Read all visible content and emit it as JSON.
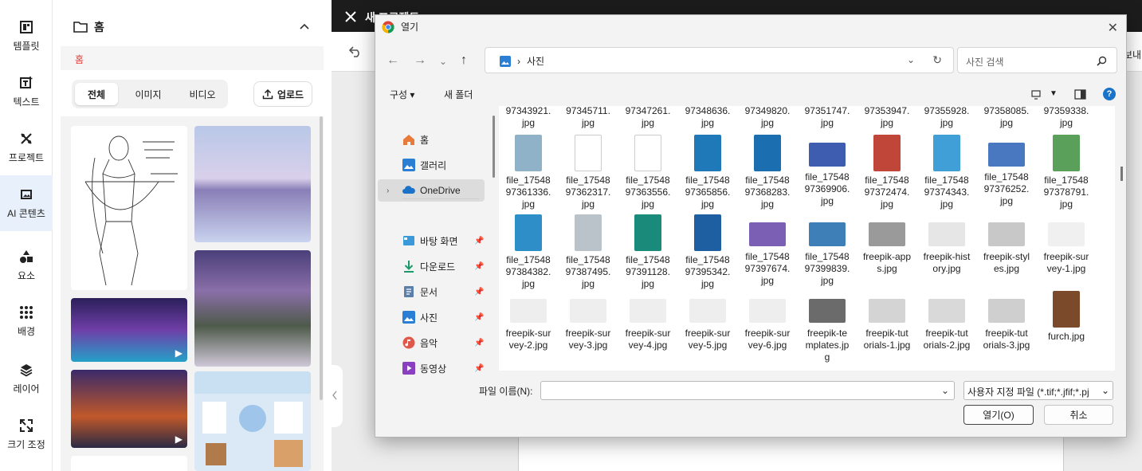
{
  "rail": [
    {
      "label": "템플릿",
      "icon": "template-icon"
    },
    {
      "label": "텍스트",
      "icon": "text-icon"
    },
    {
      "label": "프로젝트",
      "icon": "project-icon"
    },
    {
      "label": "AI 콘텐츠",
      "icon": "image-icon"
    },
    {
      "label": "요소",
      "icon": "shapes-icon"
    },
    {
      "label": "배경",
      "icon": "grid-dots-icon"
    },
    {
      "label": "레이어",
      "icon": "layers-icon"
    },
    {
      "label": "크기 조정",
      "icon": "resize-icon"
    }
  ],
  "panel": {
    "title": "홈",
    "breadcrumb": "홈",
    "filters": [
      "전체",
      "이미지",
      "비디오"
    ],
    "active_filter": "전체",
    "upload_label": "업로드"
  },
  "editor": {
    "title_fragment": "새 프로젝트",
    "export_fragment": "보내"
  },
  "dialog": {
    "title": "열기",
    "address_folder": "사진",
    "search_placeholder": "사진 검색",
    "organize_label": "구성",
    "new_folder_label": "새 폴더",
    "help_glyph": "?",
    "tree": [
      {
        "label": "홈",
        "icon": "home-icon"
      },
      {
        "label": "갤러리",
        "icon": "gallery-icon"
      },
      {
        "label": "OneDrive",
        "icon": "onedrive-icon",
        "selected": true
      },
      {
        "label": "바탕 화면",
        "icon": "desktop-icon",
        "pinned": true
      },
      {
        "label": "다운로드",
        "icon": "download-icon",
        "pinned": true
      },
      {
        "label": "문서",
        "icon": "document-icon",
        "pinned": true
      },
      {
        "label": "사진",
        "icon": "pictures-icon",
        "pinned": true
      },
      {
        "label": "음악",
        "icon": "music-icon",
        "pinned": true
      },
      {
        "label": "동영상",
        "icon": "video-icon",
        "pinned": true
      }
    ],
    "files": [
      {
        "name": "97343921.\njpg"
      },
      {
        "name": "97345711.\njpg"
      },
      {
        "name": "97347261.\njpg"
      },
      {
        "name": "97348636.\njpg"
      },
      {
        "name": "97349820.\njpg"
      },
      {
        "name": "97351747.\njpg"
      },
      {
        "name": "97353947.\njpg"
      },
      {
        "name": "97355928.\njpg"
      },
      {
        "name": "97358085.\njpg"
      },
      {
        "name": "97359338.\njpg"
      },
      {
        "name": "file_17548\n97361336.\njpg",
        "color": "#8fb2c9"
      },
      {
        "name": "file_17548\n97362317.\njpg",
        "color": "#ffffff"
      },
      {
        "name": "file_17548\n97363556.\njpg",
        "color": "#ffffff"
      },
      {
        "name": "file_17548\n97365856.\njpg",
        "color": "#1f78b8"
      },
      {
        "name": "file_17548\n97368283.\njpg",
        "color": "#1b6fb0"
      },
      {
        "name": "file_17548\n97369906.\njpg",
        "color": "#3f5db0",
        "wide": true
      },
      {
        "name": "file_17548\n97372474.\njpg",
        "color": "#c0463a"
      },
      {
        "name": "file_17548\n97374343.\njpg",
        "color": "#3f9fd6"
      },
      {
        "name": "file_17548\n97376252.\njpg",
        "color": "#4a78c0",
        "wide": true
      },
      {
        "name": "file_17548\n97378791.\njpg",
        "color": "#5aa05a"
      },
      {
        "name": "file_17548\n97384382.\njpg",
        "color": "#2e8fc8"
      },
      {
        "name": "file_17548\n97387495.\njpg",
        "color": "#b9c3c9"
      },
      {
        "name": "file_17548\n97391128.\njpg",
        "color": "#1a8a7a"
      },
      {
        "name": "file_17548\n97395342.\njpg",
        "color": "#1d5fa0"
      },
      {
        "name": "file_17548\n97397674.\njpg",
        "color": "#7b5fb4",
        "wide": true
      },
      {
        "name": "file_17548\n97399839.\njpg",
        "color": "#3f7fb8",
        "wide": true
      },
      {
        "name": "freepik-app\ns.jpg",
        "color": "#9a9a9a",
        "wide": true
      },
      {
        "name": "freepik-hist\nory.jpg",
        "color": "#e6e6e6",
        "wide": true
      },
      {
        "name": "freepik-styl\nes.jpg",
        "color": "#c8c8c8",
        "wide": true
      },
      {
        "name": "freepik-sur\nvey-1.jpg",
        "color": "#f0f0f0",
        "wide": true
      },
      {
        "name": "freepik-sur\nvey-2.jpg",
        "color": "#eeeeee",
        "wide": true
      },
      {
        "name": "freepik-sur\nvey-3.jpg",
        "color": "#eeeeee",
        "wide": true
      },
      {
        "name": "freepik-sur\nvey-4.jpg",
        "color": "#eeeeee",
        "wide": true
      },
      {
        "name": "freepik-sur\nvey-5.jpg",
        "color": "#eeeeee",
        "wide": true
      },
      {
        "name": "freepik-sur\nvey-6.jpg",
        "color": "#eeeeee",
        "wide": true
      },
      {
        "name": "freepik-te\nmplates.jp\ng",
        "color": "#6b6b6b",
        "wide": true
      },
      {
        "name": "freepik-tut\norials-1.jpg",
        "color": "#d4d4d4",
        "wide": true
      },
      {
        "name": "freepik-tut\norials-2.jpg",
        "color": "#d9d9d9",
        "wide": true
      },
      {
        "name": "freepik-tut\norials-3.jpg",
        "color": "#cfcfcf",
        "wide": true
      },
      {
        "name": "furch.jpg",
        "color": "#7a4a2a"
      }
    ],
    "filename_label": "파일 이름(N):",
    "filename_value": "",
    "filetype_value": "사용자 지정 파일 (*.tif;*.jfif;*.pj",
    "open_label": "열기(O)",
    "cancel_label": "취소"
  },
  "colors": {
    "accent_red": "#e0403a",
    "selection_blue": "#e8f0fb",
    "topbar": "#1c1c1c"
  }
}
